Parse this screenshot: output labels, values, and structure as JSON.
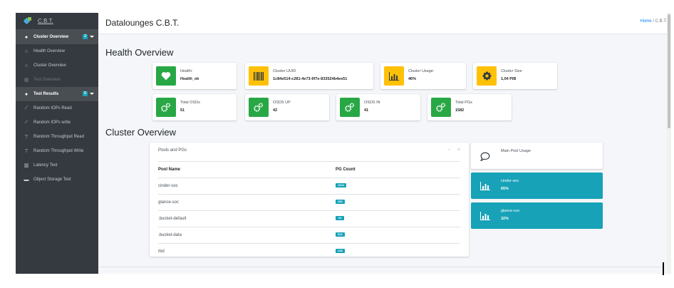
{
  "brand": {
    "name": "C.B.T."
  },
  "sidebar": {
    "groups": [
      {
        "label": "Cluster Overview",
        "badge": "3",
        "items": [
          {
            "label": "Health Overview",
            "icon": "circle-outline-icon",
            "disabled": false
          },
          {
            "label": "Cluster Overview",
            "icon": "circle-outline-icon",
            "disabled": false
          },
          {
            "label": "Test Overview",
            "icon": "grid-icon",
            "disabled": true
          }
        ]
      },
      {
        "label": "Test Results",
        "badge": "5",
        "items": [
          {
            "label": "Random IOPs Read",
            "icon": "line-chart-icon"
          },
          {
            "label": "Random IOPs write",
            "icon": "line-chart-icon"
          },
          {
            "label": "Random Throughput Read",
            "icon": "network-icon"
          },
          {
            "label": "Random Throughput Write",
            "icon": "network-icon"
          },
          {
            "label": "Latency Test",
            "icon": "bar-chart-icon"
          },
          {
            "label": "Object Storage Test",
            "icon": "storage-icon"
          }
        ]
      }
    ]
  },
  "header": {
    "title": "Datalounges C.B.T.",
    "breadcrumb": {
      "home": "Home",
      "separator": "/",
      "current": "C.B.T."
    }
  },
  "health": {
    "section_title": "Health Overview",
    "boxes": [
      {
        "label": "Health:",
        "value": "Health_ok",
        "icon": "heart-icon",
        "color": "#28a745"
      },
      {
        "label": "Cluster UUID",
        "value": "1c84e514-c281-4e73-9f7e-833524b4ee51",
        "icon": "barcode-icon",
        "color": "#ffc107"
      },
      {
        "label": "Cluster Usage:",
        "value": "46%",
        "icon": "bar-chart-icon",
        "color": "#ffc107"
      },
      {
        "label": "Cluster Size",
        "value": "1,04 PiB",
        "icon": "gear-icon",
        "color": "#ffc107"
      },
      {
        "label": "Total OSDs",
        "value": "51",
        "icon": "cogs-icon",
        "color": "#28a745"
      },
      {
        "label": "OSDS UP",
        "value": "42",
        "icon": "cogs-icon",
        "color": "#28a745"
      },
      {
        "label": "OSDS IN",
        "value": "41",
        "icon": "cogs-icon",
        "color": "#28a745"
      },
      {
        "label": "Total PGs",
        "value": "1582",
        "icon": "cogs-icon",
        "color": "#28a745"
      }
    ]
  },
  "cluster": {
    "section_title": "Cluster Overview",
    "pools_card": {
      "title": "Pools and PGs",
      "columns": [
        "Pool Name",
        "PG Count"
      ],
      "rows": [
        {
          "name": "cinder-soc",
          "pg": "1024"
        },
        {
          "name": "glance-soc",
          "pg": "256"
        },
        {
          "name": ".bucket-default",
          "pg": "64"
        },
        {
          "name": ".bucket-data",
          "pg": "512"
        },
        {
          "name": "rbd",
          "pg": "128"
        }
      ]
    },
    "main_pool": {
      "title": "Main Pool Usage"
    },
    "pool_usage": [
      {
        "label": "cinder-soc",
        "value": "65%"
      },
      {
        "label": "glance-soc",
        "value": "32%"
      }
    ]
  },
  "colors": {
    "sidebar": "#343a40",
    "teal": "#17a2b8",
    "green": "#28a745",
    "yellow": "#ffc107"
  }
}
